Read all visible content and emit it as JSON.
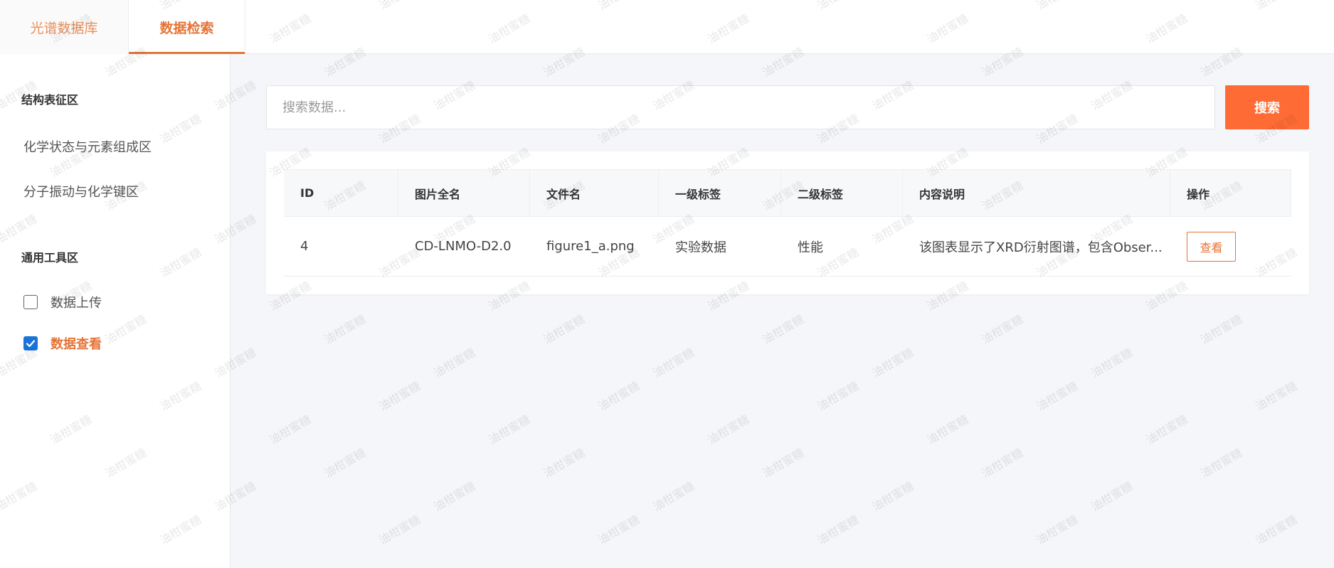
{
  "tabs": [
    {
      "label": "光谱数据库",
      "active": false
    },
    {
      "label": "数据检索",
      "active": true
    }
  ],
  "sidebar": {
    "sections": [
      {
        "title": "结构表征区",
        "items": [
          "化学状态与元素组成区",
          "分子振动与化学键区"
        ]
      },
      {
        "title": "通用工具区",
        "checks": [
          {
            "label": "数据上传",
            "checked": false
          },
          {
            "label": "数据查看",
            "checked": true
          }
        ]
      }
    ]
  },
  "search": {
    "placeholder": "搜索数据...",
    "value": "",
    "button_label": "搜索"
  },
  "table": {
    "headers": [
      "ID",
      "图片全名",
      "文件名",
      "一级标签",
      "二级标签",
      "内容说明",
      "操作"
    ],
    "rows": [
      {
        "id": "4",
        "full_name": "CD-LNMO-D2.0",
        "filename": "figure1_a.png",
        "tag1": "实验数据",
        "tag2": "性能",
        "description": "该图表显示了XRD衍射图谱，包含Obser...",
        "action_label": "查看"
      }
    ]
  },
  "watermark": {
    "text": "油柑蜜糖"
  },
  "colors": {
    "accent": "#e57335",
    "search_button": "#ff6b35",
    "checkbox": "#1a73d9"
  }
}
